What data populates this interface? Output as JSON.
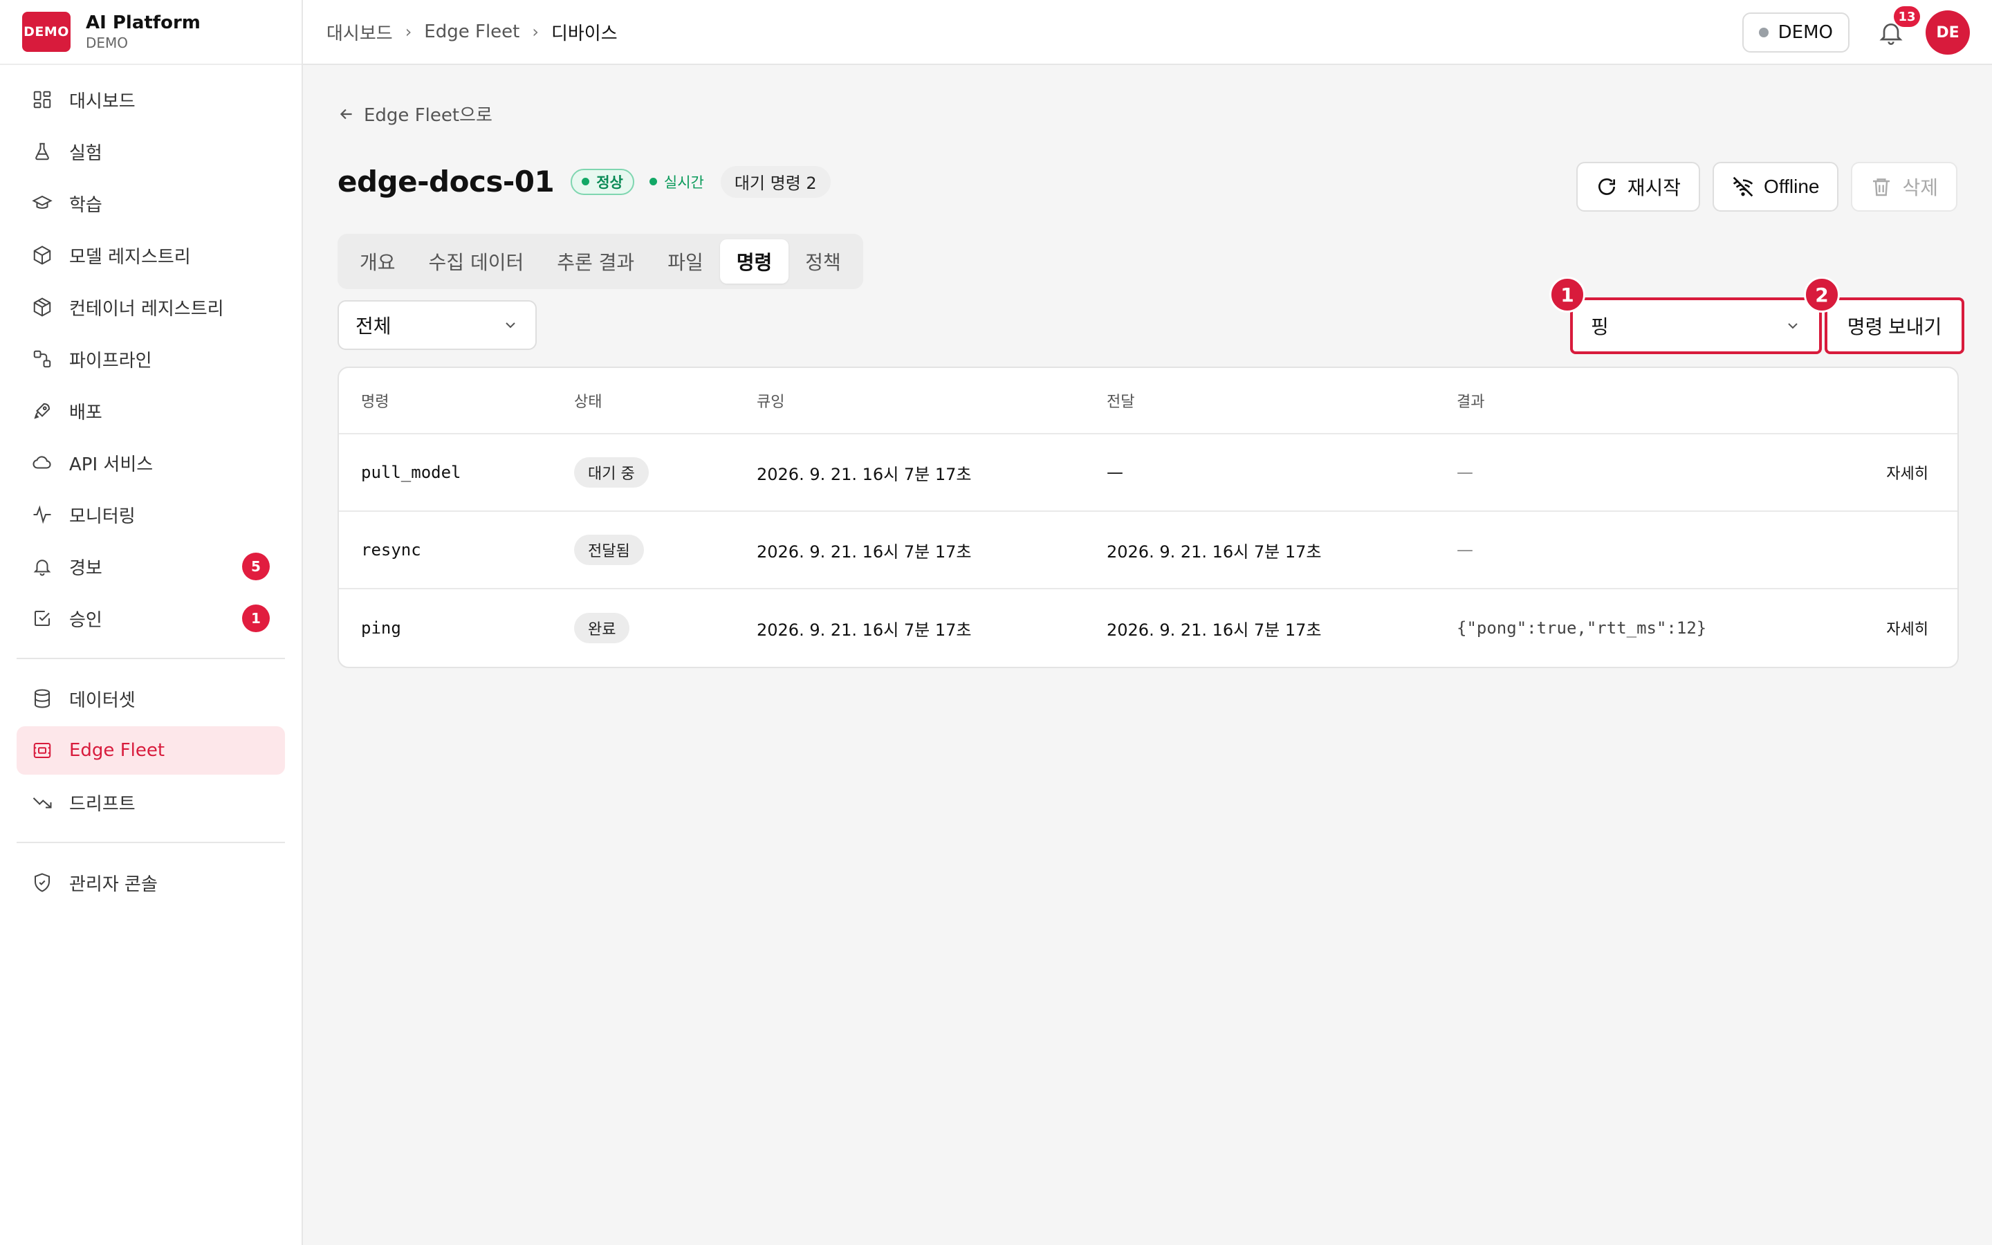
{
  "brand": {
    "logo_text": "DEMO",
    "title": "AI Platform",
    "subtitle": "DEMO"
  },
  "sidebar": {
    "items": [
      {
        "label": "대시보드",
        "icon": "dashboard-icon"
      },
      {
        "label": "실험",
        "icon": "flask-icon"
      },
      {
        "label": "학습",
        "icon": "graduation-cap-icon"
      },
      {
        "label": "모델 레지스트리",
        "icon": "cube-icon"
      },
      {
        "label": "컨테이너 레지스트리",
        "icon": "container-icon"
      },
      {
        "label": "파이프라인",
        "icon": "pipeline-icon"
      },
      {
        "label": "배포",
        "icon": "rocket-icon"
      },
      {
        "label": "API 서비스",
        "icon": "cloud-icon"
      },
      {
        "label": "모니터링",
        "icon": "activity-icon"
      },
      {
        "label": "경보",
        "icon": "bell-icon",
        "badge": "5"
      },
      {
        "label": "승인",
        "icon": "checkbox-icon",
        "badge": "1"
      }
    ],
    "items2": [
      {
        "label": "데이터셋",
        "icon": "database-icon"
      },
      {
        "label": "Edge Fleet",
        "icon": "edge-device-icon",
        "active": true
      },
      {
        "label": "드리프트",
        "icon": "trending-down-icon"
      }
    ],
    "items3": [
      {
        "label": "관리자 콘솔",
        "icon": "shield-icon"
      }
    ]
  },
  "header": {
    "breadcrumb": [
      "대시보드",
      "Edge Fleet",
      "디바이스"
    ],
    "demo_label": "DEMO",
    "notification_count": "13",
    "avatar_initials": "DE"
  },
  "page": {
    "back_label": "Edge Fleet으로",
    "device_name": "edge-docs-01",
    "status_badge": "정상",
    "live_badge": "실시간",
    "queue_badge": "대기 명령 2",
    "actions": {
      "restart": "재시작",
      "offline": "Offline",
      "delete": "삭제"
    },
    "tabs": [
      "개요",
      "수집 데이터",
      "추론 결과",
      "파일",
      "명령",
      "정책"
    ],
    "active_tab": "명령",
    "filter_value": "전체",
    "command_select_value": "핑",
    "send_label": "명령 보내기",
    "markers": [
      "1",
      "2"
    ]
  },
  "table": {
    "columns": [
      "명령",
      "상태",
      "큐잉",
      "전달",
      "결과"
    ],
    "rows": [
      {
        "command": "pull_model",
        "status": "대기 중",
        "queued": "2026. 9. 21. 16시 7분 17초",
        "delivered": "—",
        "result": "—",
        "action": "자세히"
      },
      {
        "command": "resync",
        "status": "전달됨",
        "queued": "2026. 9. 21. 16시 7분 17초",
        "delivered": "2026. 9. 21. 16시 7분 17초",
        "result": "—",
        "action": ""
      },
      {
        "command": "ping",
        "status": "완료",
        "queued": "2026. 9. 21. 16시 7분 17초",
        "delivered": "2026. 9. 21. 16시 7분 17초",
        "result": "{\"pong\":true,\"rtt_ms\":12}",
        "action": "자세히"
      }
    ]
  },
  "colors": {
    "accent": "#d81b3c",
    "active_bg": "#fde7ea",
    "success": "#0a8a55"
  }
}
